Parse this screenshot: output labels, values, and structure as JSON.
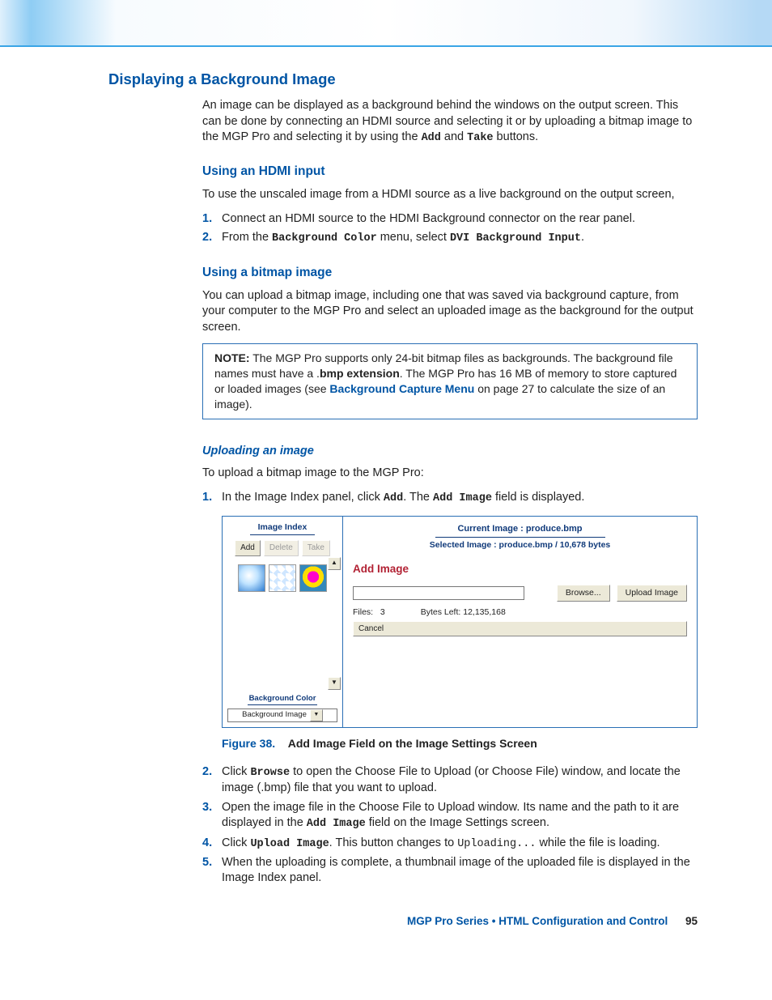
{
  "header": {
    "decor_only": true
  },
  "section": {
    "title": "Displaying a Background Image",
    "intro_a": "An image can be displayed as a background behind the windows on the output screen. This can be done by connecting an HDMI source and selecting it or by uploading a bitmap image to the MGP Pro and selecting it by using the ",
    "intro_add": "Add",
    "intro_b": " and ",
    "intro_take": "Take",
    "intro_c": " buttons."
  },
  "hdmi": {
    "title": "Using an HDMI input",
    "lead": "To use the unscaled image from a HDMI source as a live background on the output screen,",
    "step1": "Connect an HDMI source to the HDMI Background connector on the rear panel.",
    "step2_a": "From the ",
    "step2_menu": "Background Color",
    "step2_b": " menu, select ",
    "step2_opt": "DVI Background Input",
    "step2_c": "."
  },
  "bitmap": {
    "title": "Using a bitmap image",
    "para": "You can upload a bitmap image, including one that was saved via background capture, from your computer to the MGP Pro and select an uploaded image as the background for the output screen."
  },
  "note": {
    "lead": "NOTE:",
    "a": "  The MGP Pro supports only 24-bit bitmap files as backgrounds. The background file names must have a .",
    "ext": "bmp extension",
    "b": ". The MGP Pro has 16 MB of memory to store captured or loaded images (see ",
    "link": "Background Capture Menu",
    "c": " on page 27 to calculate the size of an image)."
  },
  "upload": {
    "title": "Uploading an image",
    "lead": "To upload a bitmap image to the MGP Pro:",
    "s1_a": "In the Image Index panel, click ",
    "s1_add": "Add",
    "s1_b": ". The ",
    "s1_addimg": "Add Image",
    "s1_c": " field is displayed.",
    "s2_a": "Click ",
    "s2_browse": "Browse",
    "s2_b": " to open the Choose File to Upload (or Choose File) window, and locate the image (.bmp) file that you want to upload.",
    "s3_a": "Open the image file in the Choose File to Upload window. Its name and the path to it are displayed in the ",
    "s3_addimg": "Add Image",
    "s3_b": " field on the Image Settings screen.",
    "s4_a": "Click ",
    "s4_upl": "Upload Image",
    "s4_b": ". This button changes to ",
    "s4_uploading": "Uploading...",
    "s4_c": " while the file is loading.",
    "s5": "When the uploading is complete, a thumbnail image of the uploaded file is displayed in the Image Index panel."
  },
  "figure": {
    "num": "Figure 38.",
    "caption": "Add Image Field on the Image Settings Screen"
  },
  "shot": {
    "left": {
      "title": "Image Index",
      "btn_add": "Add",
      "btn_delete": "Delete",
      "btn_take": "Take",
      "bg_label": "Background Color",
      "bg_select": "Background Image"
    },
    "right": {
      "current_a": "Current Image : ",
      "current_b": "produce.bmp",
      "selected": "Selected Image : produce.bmp / 10,678 bytes",
      "add_image": "Add Image",
      "browse": "Browse...",
      "upload": "Upload Image",
      "files_label": "Files:",
      "files_val": "3",
      "bytes_left": "Bytes Left: 12,135,168",
      "cancel": "Cancel"
    }
  },
  "footer": {
    "title": "MGP Pro Series • HTML Configuration and Control",
    "page": "95"
  }
}
